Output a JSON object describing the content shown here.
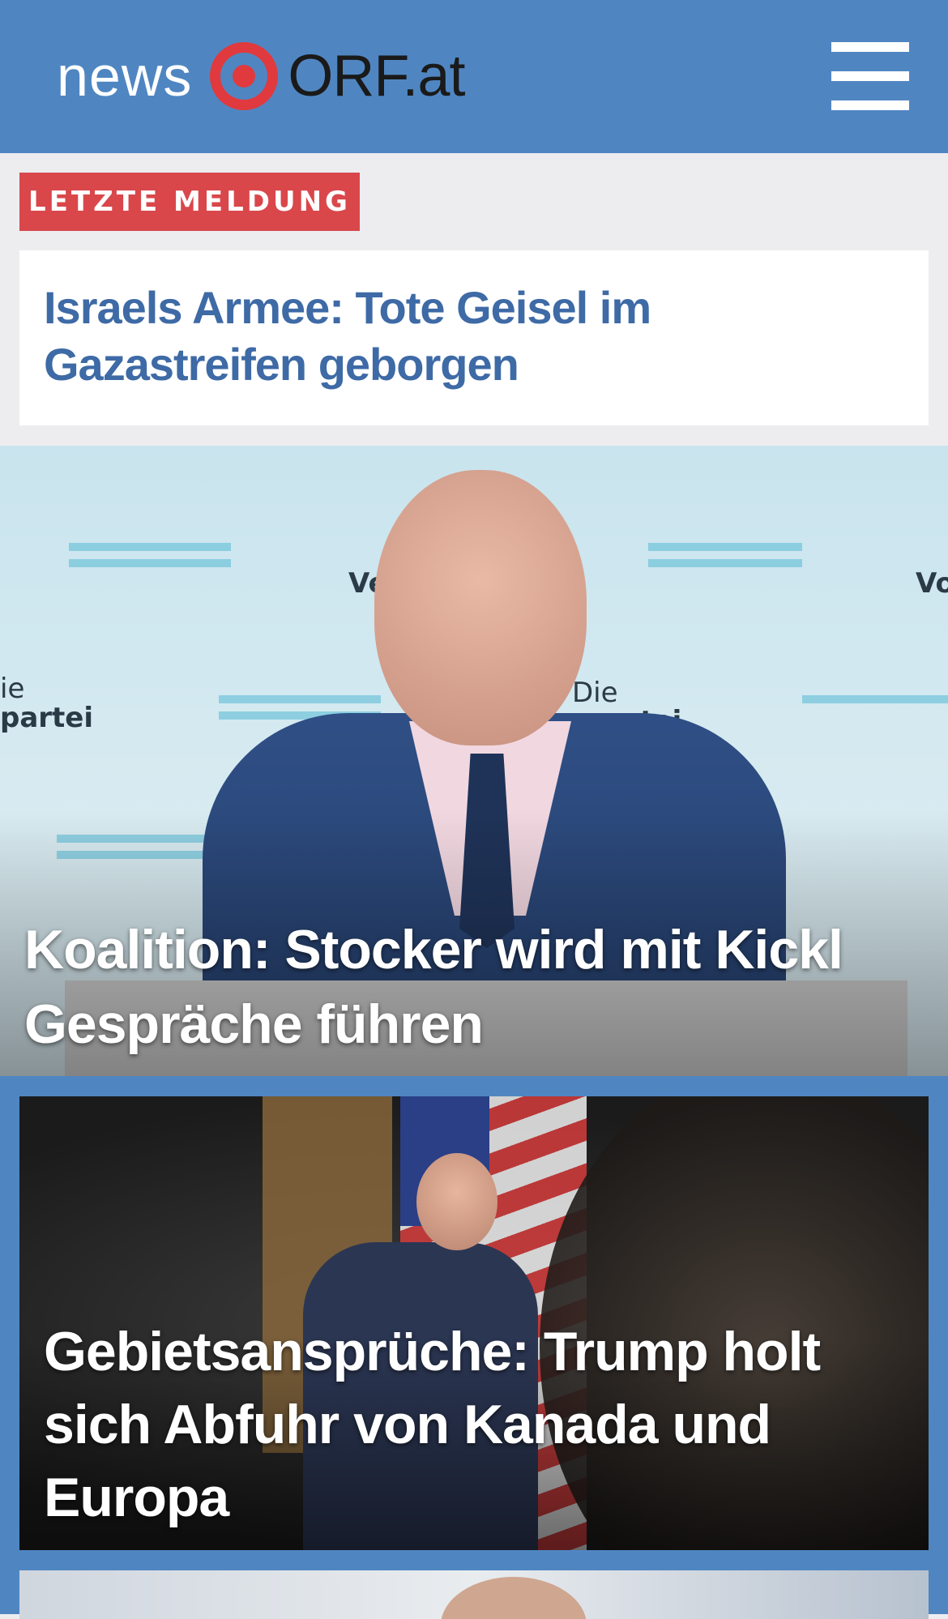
{
  "header": {
    "logo_news": "news",
    "logo_orf": "ORF.at",
    "menu_icon": "hamburger-menu-icon",
    "bg_color": "#4f86c2"
  },
  "breaking": {
    "label": "LETZTE MELDUNG",
    "headline": "Israels Armee: Tote Geisel im Gazastreifen geborgen",
    "label_color": "#d9474b",
    "headline_color": "#3e6aa6"
  },
  "stories": [
    {
      "headline": "Koalition: Stocker wird mit Kickl Gespräche führen"
    },
    {
      "headline": "Gebietsansprüche: Trump holt sich Abfuhr von Kanada und Europa"
    }
  ],
  "hero_image": {
    "wall_text": [
      "Ve",
      "Die",
      "spartei",
      "ie",
      "partei",
      "Vo"
    ]
  }
}
